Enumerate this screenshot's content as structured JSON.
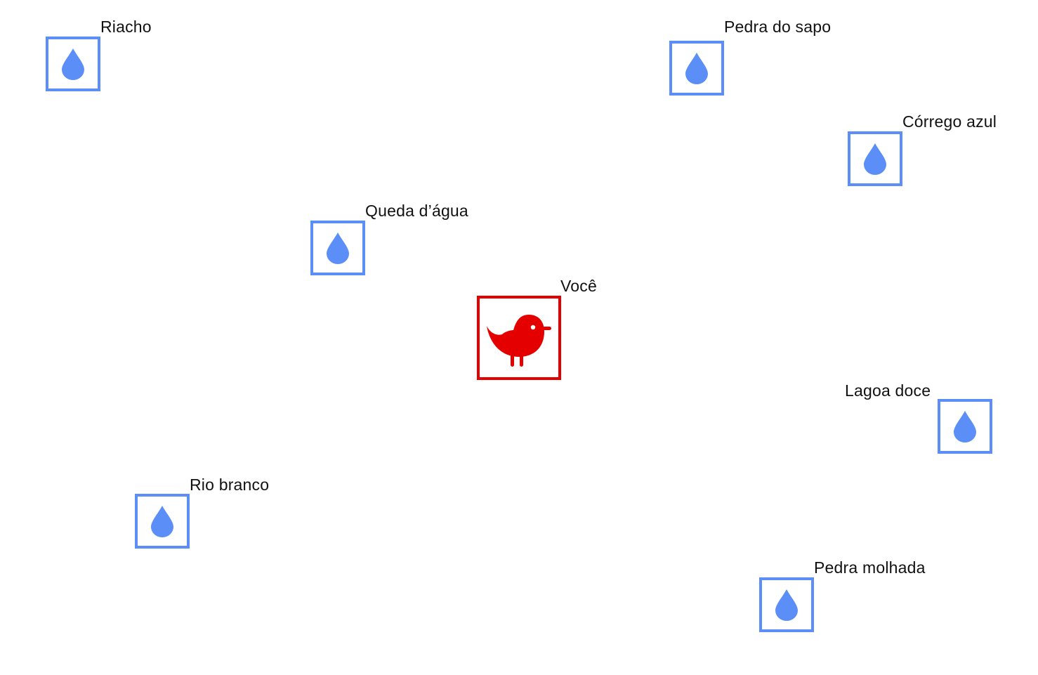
{
  "colors": {
    "water": "#5b8ef7",
    "you": "#e50000",
    "label": "#111111"
  },
  "you": {
    "label": "Você",
    "icon": "bird-icon"
  },
  "water_sources": [
    {
      "label": "Riacho",
      "icon": "water-drop-icon"
    },
    {
      "label": "Pedra do sapo",
      "icon": "water-drop-icon"
    },
    {
      "label": "Córrego azul",
      "icon": "water-drop-icon"
    },
    {
      "label": "Queda d’água",
      "icon": "water-drop-icon"
    },
    {
      "label": "Lagoa doce",
      "icon": "water-drop-icon"
    },
    {
      "label": "Rio branco",
      "icon": "water-drop-icon"
    },
    {
      "label": "Pedra molhada",
      "icon": "water-drop-icon"
    }
  ]
}
